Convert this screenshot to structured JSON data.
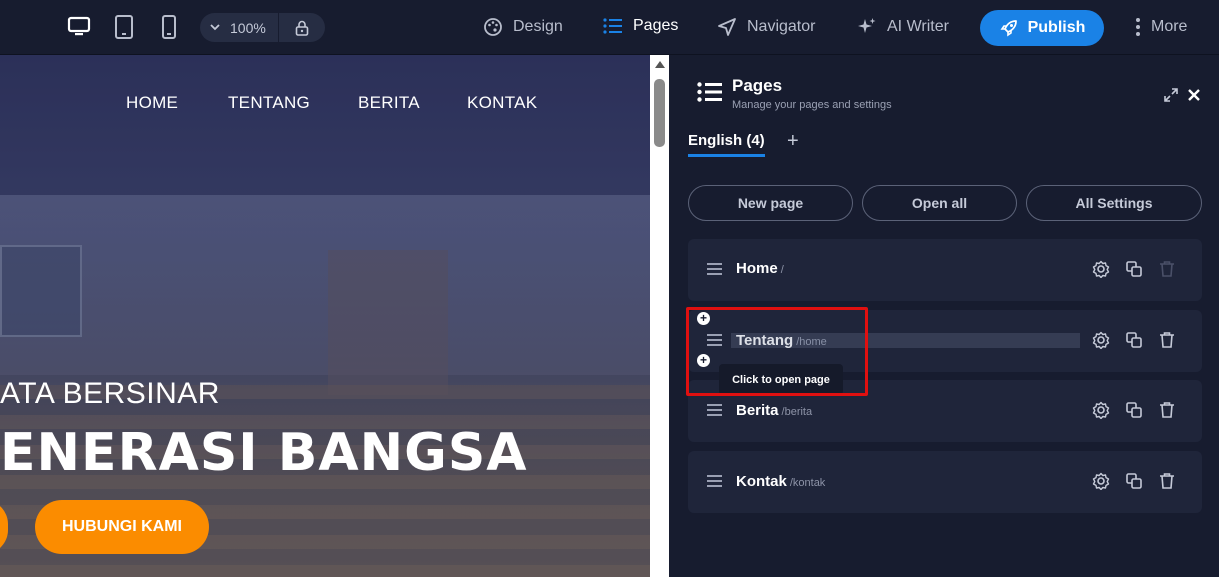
{
  "topbar": {
    "zoom": "100%",
    "design_label": "Design",
    "pages_label": "Pages",
    "navigator_label": "Navigator",
    "ai_writer_label": "AI Writer",
    "publish_label": "Publish",
    "more_label": "More"
  },
  "site": {
    "nav": [
      "HOME",
      "TENTANG",
      "BERITA",
      "KONTAK"
    ],
    "hero_small": "ATA BERSINAR",
    "hero_big": "ENERASI BANGSA",
    "cta": "HUBUNGI KAMI"
  },
  "panel": {
    "title": "Pages",
    "subtitle": "Manage your pages and settings",
    "tab": "English (4)",
    "buttons": [
      "New page",
      "Open all",
      "All Settings"
    ],
    "pages": [
      {
        "name": "Home",
        "slug": "/"
      },
      {
        "name": "Tentang",
        "slug": "/home"
      },
      {
        "name": "Berita",
        "slug": "/berita"
      },
      {
        "name": "Kontak",
        "slug": "/kontak"
      }
    ],
    "tooltip": "Click to open page"
  },
  "colors": {
    "accent": "#1a82e6",
    "orange": "#fb8c00",
    "highlight": "#e01010",
    "panel_bg": "#171c2f"
  }
}
